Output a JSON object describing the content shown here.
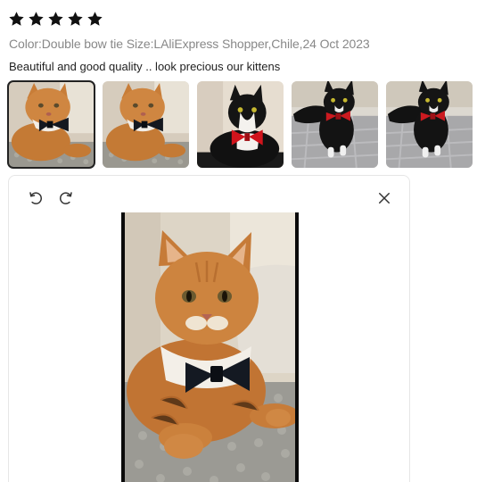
{
  "rating": {
    "stars": 5,
    "max_stars": 5,
    "star_color": "#111111"
  },
  "meta": {
    "color_label": "Color:",
    "color_value": "Double bow tie",
    "size_label": "Size:",
    "size_value": "LAliExpress Shopper,Chile,24 Oct 2023"
  },
  "review": {
    "text": "Beautiful and good quality .. look precious our kittens"
  },
  "thumbnails": [
    {
      "icon": "orange-cat-black-bowtie-photo",
      "selected": true
    },
    {
      "icon": "orange-cat-black-bowtie-photo",
      "selected": false
    },
    {
      "icon": "tuxedo-cat-red-bowtie-photo",
      "selected": false
    },
    {
      "icon": "black-cat-red-bowtie-photo",
      "selected": false
    },
    {
      "icon": "black-cat-red-bowtie-photo",
      "selected": false
    }
  ],
  "viewer": {
    "rotate_left_icon": "rotate-left-icon",
    "rotate_right_icon": "rotate-right-icon",
    "close_icon": "close-icon"
  },
  "colors": {
    "meta_text": "#888888",
    "body_text": "#222222",
    "border": "#e6e6e6"
  }
}
